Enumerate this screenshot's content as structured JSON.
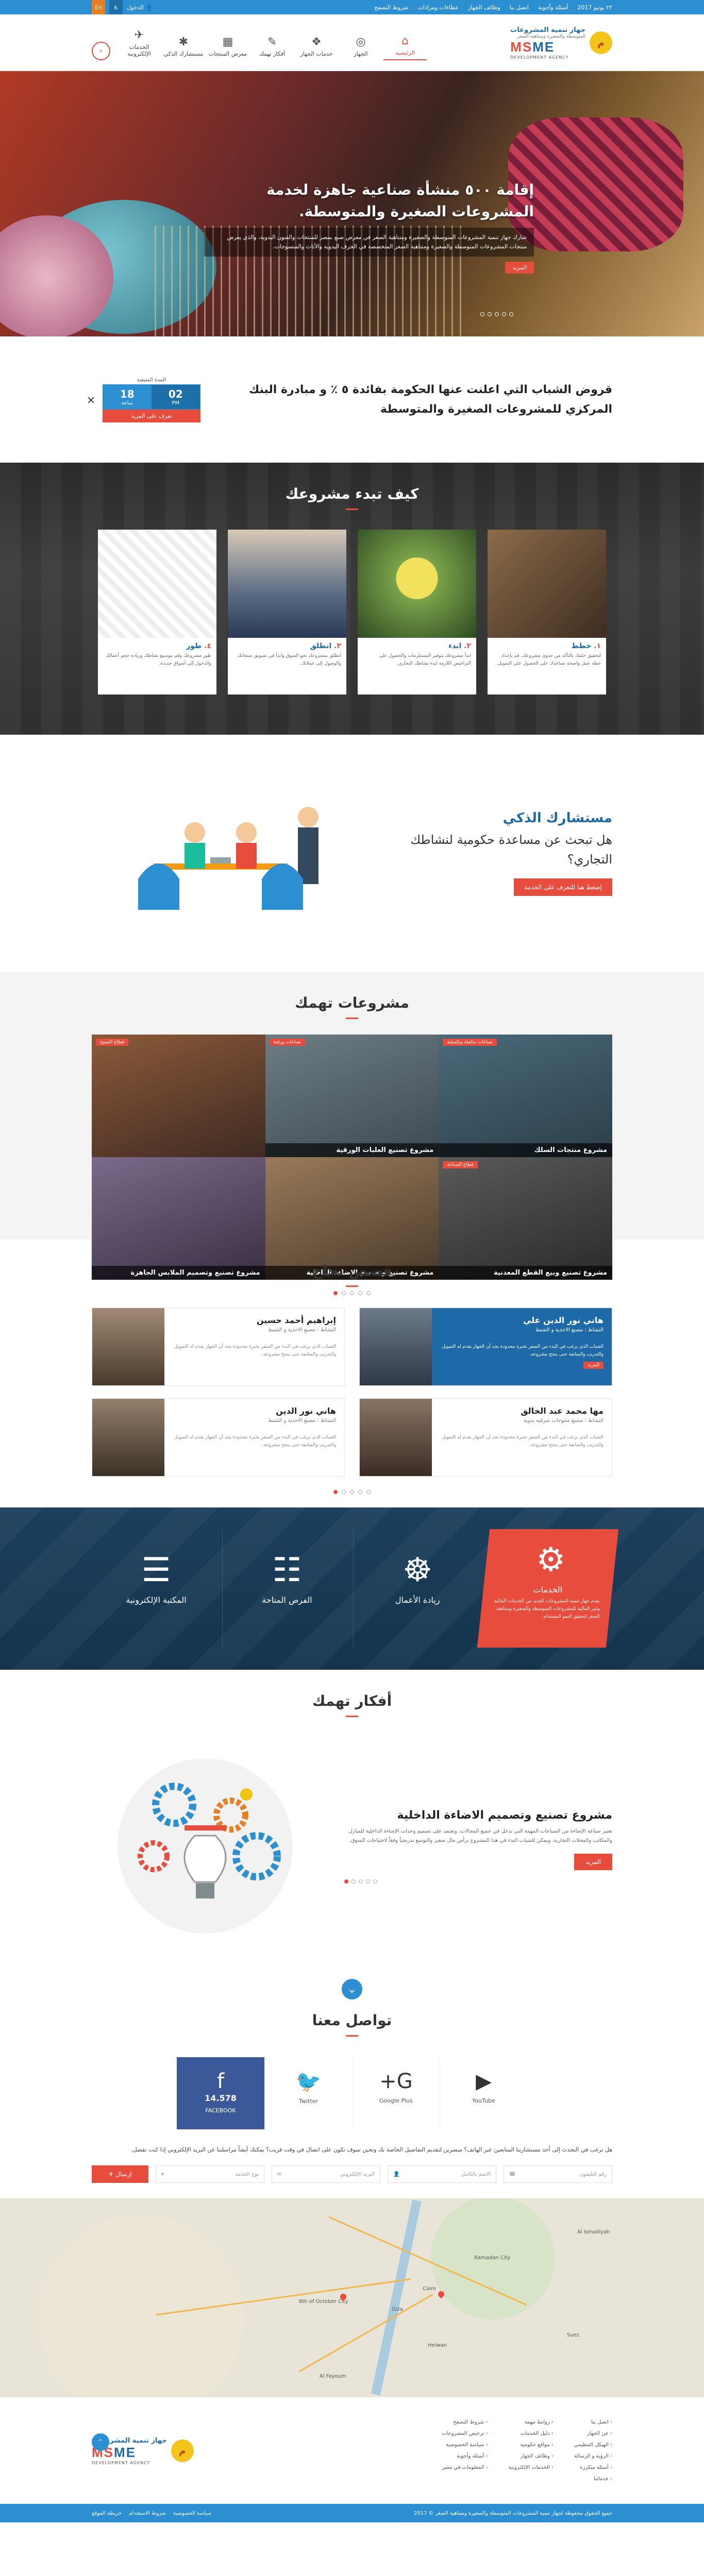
{
  "topbar": {
    "date": "٢٢ يونيو 2017",
    "links": [
      "أسئلة وأجوبة",
      "اتصل بنا",
      "وظائف الجهاز",
      "عطاءات ومزادات",
      "شروط التصفح"
    ],
    "login": "الدخول",
    "lang": "En"
  },
  "logo": {
    "emblem_text": "م",
    "ar_line1": "جهاز تنمية المشروعات",
    "ar_line2": "المتوسطة والصغيرة ومتناهية الصغر",
    "brand": "MSME",
    "tagline": "DEVELOPMENT AGENCY"
  },
  "nav": [
    {
      "label": "الرئيسية",
      "icon": "home-icon",
      "active": true
    },
    {
      "label": "الجهاز",
      "icon": "globe-icon"
    },
    {
      "label": "خدمات الجهاز",
      "icon": "services-icon"
    },
    {
      "label": "أفكار تهمك",
      "icon": "ideas-icon"
    },
    {
      "label": "معرض المنتجات",
      "icon": "gallery-icon"
    },
    {
      "label": "مستشارك الذكي",
      "icon": "advisor-icon"
    },
    {
      "label": "الخدمات الإلكترونية",
      "icon": "eservices-icon"
    }
  ],
  "hero": {
    "title": "إقامة ٥٠٠ منشأة صناعية جاهزة لخدمة المشروعات الصغيرة والمتوسطة.",
    "text": "شارك جهاز تنمية المشروعات المتوسطة والصغيرة ومتناهية الصغر في معرض صنع بمصر للمنتجات والفنون اليدوية، والذي يعرض منتجات المشروعات المتوسطة والصغيرة ومتناهية الصغر المتخصصة في الحرف اليدوية والأثاث والمنسوجات.",
    "button": "المزيد"
  },
  "news": {
    "headline": "قروض الشباب التي اعلنت عنها الحكومة بفائدة ٥ ٪ و مبادرة البنك المركزي للمشروعات الصغيرة والمتوسطة",
    "label": "المدة المتبقية",
    "hours": "18",
    "hours_label": "ساعة",
    "minutes": "02",
    "minutes_label": "PM",
    "more": "تعرف على المزيد",
    "close": "×"
  },
  "how": {
    "title": "كيف تبدء مشروعك",
    "cards": [
      {
        "num": "١.",
        "title": "خطط",
        "text": "لتحقيق حلمك بالتأكد من جدوى مشروعك، قم بإعداد خطة عمل واضحة تساعدك على الحصول على التمويل."
      },
      {
        "num": "٢.",
        "title": "ابدء",
        "text": "ابدأ مشروعك بتوفير المستلزمات والحصول على التراخيص اللازمة لبدء نشاطك التجاري."
      },
      {
        "num": "٣.",
        "title": "انطلق",
        "text": "انطلق بمشروعك نحو السوق وابدأ في تسويق منتجاتك والوصول إلى عملائك."
      },
      {
        "num": "٤.",
        "title": "طور",
        "text": "طور مشروعك وقم بتوسيع نشاطك وزيادة حجم أعمالك والدخول إلى أسواق جديدة."
      }
    ]
  },
  "advisor": {
    "title": "مستشارك الذكي",
    "text": "هل تبحث عن مساعدة حكومية لنشاطك التجاري؟",
    "button": "إضغط هنا للتعرف على الخدمة"
  },
  "projects": {
    "title": "مشروعات تهمك",
    "items": [
      {
        "label": "مشروع منتجات السلك",
        "tag": "صناعات مكملة وتكميلية",
        "color1": "#4a6a7a",
        "color2": "#2c3e4a"
      },
      {
        "label": "مشروع تصنيع العلبات الورقية",
        "tag": "صناعات ورقية",
        "color1": "#6e7c84",
        "color2": "#3d4a52"
      },
      {
        "label": "",
        "tag": "قطاع النسيج",
        "color1": "#8c5a3a",
        "color2": "#3f2a22"
      },
      {
        "label": "مشروع تصنيع وبيع القطع المعدنية",
        "tag": "قطاع الصناعة",
        "color1": "#5a5a5a",
        "color2": "#2a2a2a"
      },
      {
        "label": "مشروع تصنيع وتصميم الاضاءة الداخلية",
        "tag": "",
        "color1": "#9a7a5a",
        "color2": "#4a3a2a"
      },
      {
        "label": "مشروع تصنيع وتصميم الملابس الجاهزة",
        "tag": "",
        "color1": "#7a6a8a",
        "color2": "#3a2f44"
      }
    ]
  },
  "success": {
    "title": "قصص نجاح",
    "stories": [
      {
        "name": "هاني نور الدين علي",
        "role": "النشاط : مصنع الاحذية و الشنط",
        "text": "الشباب الذي يرغب في البدء من الصفر بخبرة محدودة يجد أن الجهاز يقدم له التمويل والتدريب والمتابعة حتى ينجح مشروعه.",
        "more": "المزيد"
      },
      {
        "name": "إبراهيم أحمد حسين",
        "role": "النشاط : مصنع الاحذية و الشنط",
        "text": "الشباب الذي يرغب في البدء من الصفر بخبرة محدودة يجد أن الجهاز يقدم له التمويل والتدريب والمتابعة حتى ينجح مشروعه."
      },
      {
        "name": "مها محمد عبد الخالق",
        "role": "النشاط : مصنع منتوجات شرقية يدوية",
        "text": "الشباب الذي يرغب في البدء من الصفر بخبرة محدودة يجد أن الجهاز يقدم له التمويل والتدريب والمتابعة حتى ينجح مشروعه."
      },
      {
        "name": "هاني نور الدين",
        "role": "النشاط : مصنع الاحذية و الشنط",
        "text": "الشباب الذي يرغب في البدء من الصفر بخبرة محدودة يجد أن الجهاز يقدم له التمويل والتدريب والمتابعة حتى ينجح مشروعه."
      }
    ]
  },
  "services": {
    "items": [
      {
        "label": "الخدمات",
        "icon": "badge-icon",
        "text": "يقدم جهاز تنمية المشروعات العديد من الخدمات المالية وغير المالية للمشروعات المتوسطة والصغيرة ومتناهية الصغر لتحقيق النمو المستدام."
      },
      {
        "label": "ريادة الأعمال",
        "icon": "entrepreneur-icon"
      },
      {
        "label": "الفرص المتاحة",
        "icon": "opportunities-icon"
      },
      {
        "label": "المكتبة الإلكترونية",
        "icon": "library-icon"
      }
    ]
  },
  "ideas": {
    "title": "أفكار تهمك",
    "headline": "مشروع تصنيع وتصميم الاضاءة الداخلية",
    "text": "تعتبر صناعة الإضاءة من الصناعات المهمة التي تدخل في جميع المجالات، وتعتمد على تصميم وحدات الإضاءة الداخلية للمنازل والمكاتب والمحلات التجارية، ويمكن للشباب البدء في هذا المشروع برأس مال صغير والتوسع تدريجياً وفقاً لاحتياجات السوق.",
    "button": "المزيد"
  },
  "contact": {
    "title": "تواصل معنا",
    "social": [
      {
        "label": "FACEBOOK",
        "count": "14.578",
        "icon": "facebook-icon"
      },
      {
        "label": "Twitter",
        "icon": "twitter-icon"
      },
      {
        "label": "Google Plus",
        "icon": "google-plus-icon"
      },
      {
        "label": "YouTube",
        "icon": "youtube-icon"
      }
    ],
    "question": "هل ترغب في التحدث إلى أحد مستشارينا المتابعين عبر الهاتف؟ ميسرين لتقديم التفاصيل الخاصة بك وتحين سوف نكون على اتصال في وقت قريب؟ يمكنك أيضاً مراسلتنا عن البريد الإلكتروني إذا كنت تفضل.",
    "fields": [
      {
        "placeholder": "رقم التليفون"
      },
      {
        "placeholder": "الاسم بالكامل"
      },
      {
        "placeholder": "البريد الإلكتروني"
      },
      {
        "placeholder": "نوع الخدمة"
      }
    ],
    "send": "إرسال"
  },
  "map": {
    "cities": [
      "Cairo",
      "Giza",
      "6th of October City",
      "Ramadan City",
      "Helwan",
      "Suez",
      "Al Ismailiyah",
      "Al Fayoum"
    ]
  },
  "footer": {
    "col1": [
      "اتصل بنا",
      "عن الجهاز",
      "الهيكل التنظيمي",
      "الرؤية و الرسالة",
      "أسئلة متكررة",
      "خدماتنا"
    ],
    "col2": [
      "روابط مهمة",
      "دليل الخدمات",
      "مواقع حكومية",
      "وظائف الجهاز",
      "الخدمات الإلكترونية"
    ],
    "col3": [
      "شروط التصفح",
      "ترخيص المشروعات",
      "سياسة الخصوصية",
      "أسئلة وأجوبة",
      "المعلومات في مصر"
    ],
    "copyright": "جميع الحقوق محفوظة لجهاز تنمية المشروعات المتوسطة والصغيرة ومتناهية الصغر © 2017",
    "bottom_links": [
      "سياسة الخصوصية",
      "شروط الاستخدام",
      "خريطة الموقع"
    ]
  }
}
